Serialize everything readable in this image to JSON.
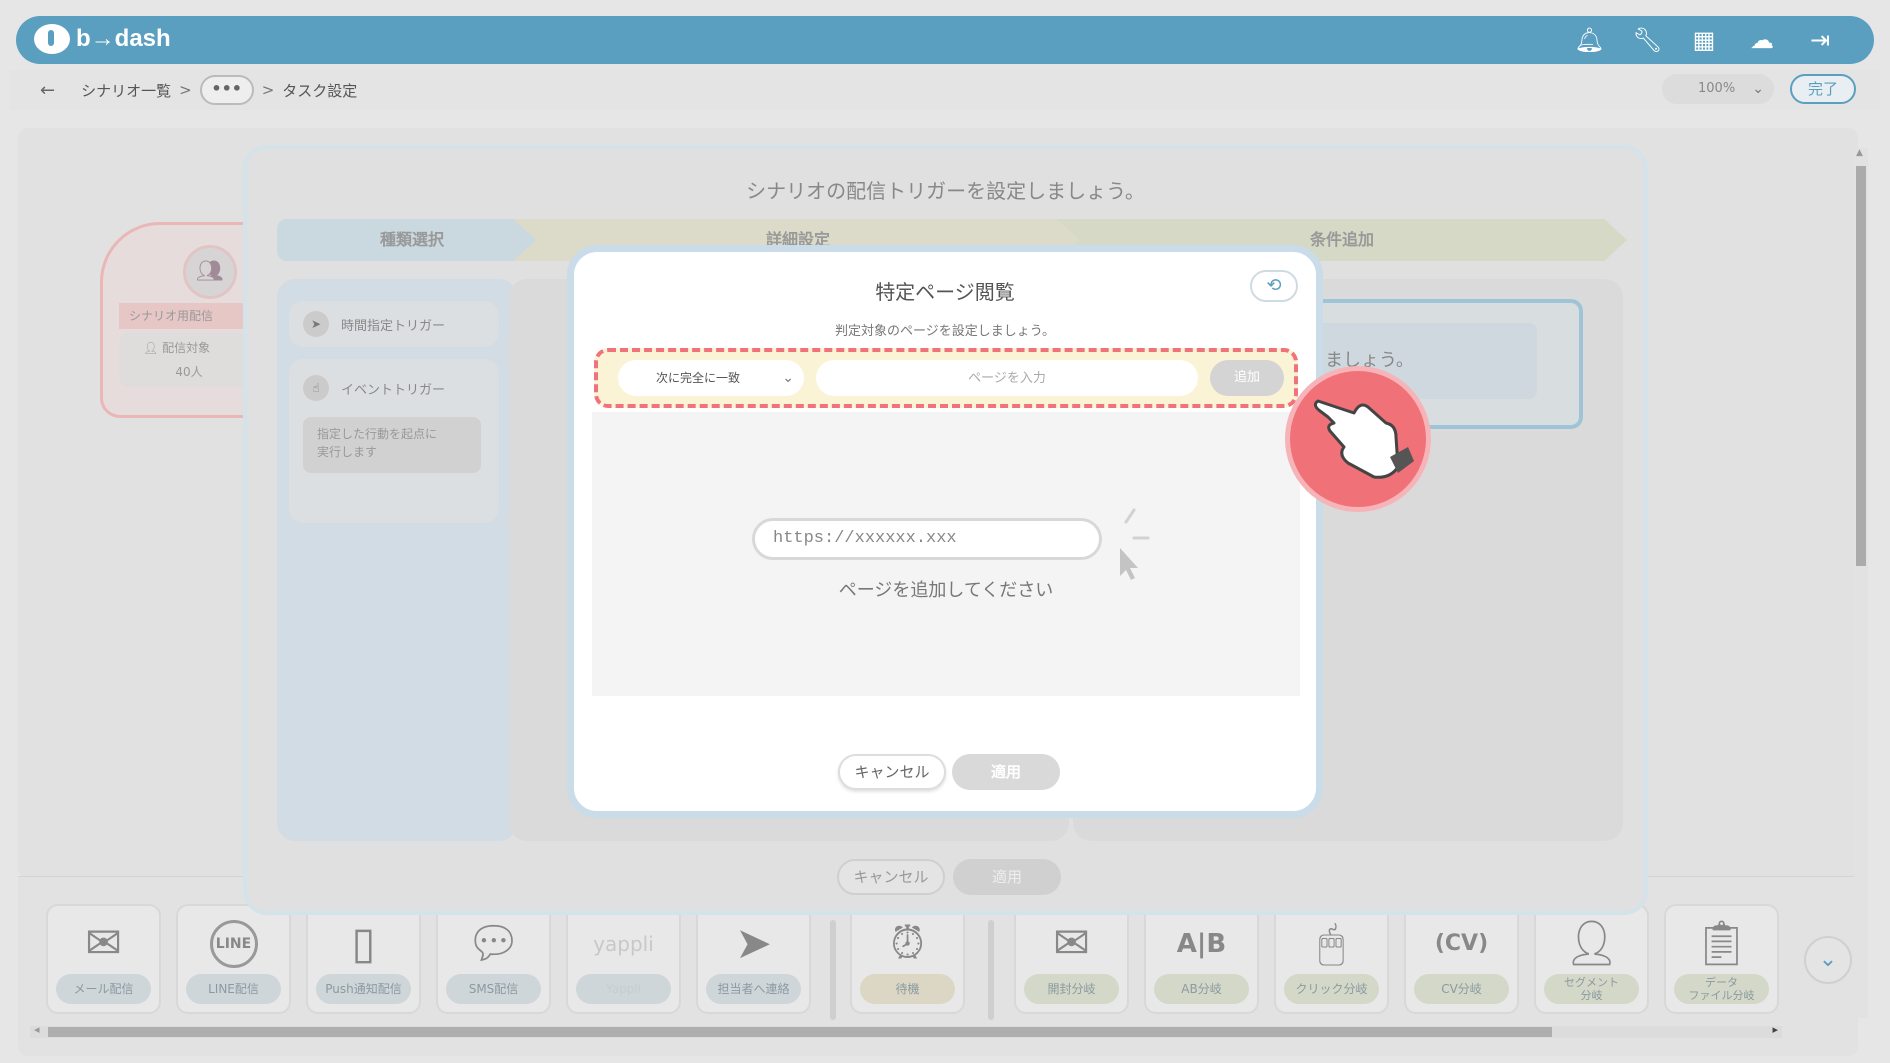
{
  "header": {
    "logo_text": "b→dash",
    "icons": [
      "bell-icon",
      "wrench-icon",
      "grid-icon",
      "notification-cloud-icon",
      "logout-icon"
    ]
  },
  "breadcrumb": {
    "back": "←",
    "scenario_list": "シナリオ一覧",
    "sep": ">",
    "more": "•••",
    "current": "タスク設定"
  },
  "zoom": {
    "value": "100%"
  },
  "done_label": "完了",
  "node": {
    "title": "シナリオ用配信",
    "target_label": "配信対象",
    "count": "40人"
  },
  "wizard": {
    "title": "シナリオの配信トリガーを設定しましょう。",
    "steps": [
      "種類選択",
      "詳細設定",
      "条件追加"
    ],
    "time_trigger": "時間指定トリガー",
    "event_trigger": "イベントトリガー",
    "event_desc_1": "指定した行動を起点に",
    "event_desc_2": "実行します",
    "right_text": "しましょう。",
    "cancel": "キャンセル",
    "apply": "適用"
  },
  "modal": {
    "title": "特定ページ閲覧",
    "subtitle": "判定対象のページを設定しましょう。",
    "match_option": "次に完全に一致",
    "page_placeholder": "ページを入力",
    "add_label": "追加",
    "illustration_url": "https://xxxxxx.xxx",
    "empty_message": "ページを追加してください",
    "cancel": "キャンセル",
    "apply": "適用"
  },
  "tools": [
    {
      "label": "メール配信",
      "icon": "mail-icon"
    },
    {
      "label": "LINE配信",
      "icon": "line-icon"
    },
    {
      "label": "Push通知配信",
      "icon": "push-icon"
    },
    {
      "label": "SMS配信",
      "icon": "sms-icon"
    },
    {
      "label": "Yappli",
      "icon": "yappli-icon",
      "logo": "yappli"
    },
    {
      "label": "担当者へ連絡",
      "icon": "paper-plane-icon"
    },
    {
      "label": "待機",
      "icon": "clock-icon"
    },
    {
      "label": "開封分岐",
      "icon": "open-mail-icon"
    },
    {
      "label": "AB分岐",
      "icon": "ab-icon"
    },
    {
      "label": "クリック分岐",
      "icon": "mouse-icon"
    },
    {
      "label": "CV分岐",
      "icon": "cv-icon"
    },
    {
      "label_1": "セグメント",
      "label_2": "分岐",
      "icon": "segment-icon"
    },
    {
      "label_1": "データ",
      "label_2": "ファイル分岐",
      "icon": "data-file-icon"
    }
  ],
  "colors": {
    "accent": "#5a9fc0",
    "highlight": "#f0727a"
  }
}
